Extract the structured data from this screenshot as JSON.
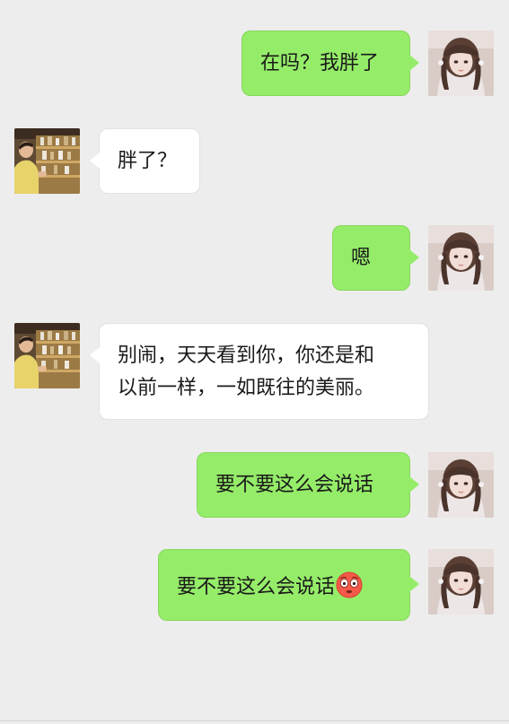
{
  "messages": [
    {
      "sender": "me",
      "text": "在吗？我胖了"
    },
    {
      "sender": "them",
      "text": "胖了？"
    },
    {
      "sender": "me",
      "text": "嗯"
    },
    {
      "sender": "them",
      "lines": [
        "别闹，天天看到你，你还是和",
        "以前一样，一如既往的美丽。"
      ]
    },
    {
      "sender": "me",
      "text": "要不要这么会说话"
    },
    {
      "sender": "me",
      "text": "要不要这么会说话",
      "emoji": "flushed-face-emoji"
    }
  ],
  "colors": {
    "background": "#ededed",
    "my_bubble": "#95ec69",
    "their_bubble": "#ffffff",
    "text": "#191919"
  },
  "icons": {
    "my_avatar": "girl-avatar-photo",
    "their_avatar": "man-avatar-photo",
    "emoji": "flushed-face-emoji"
  }
}
